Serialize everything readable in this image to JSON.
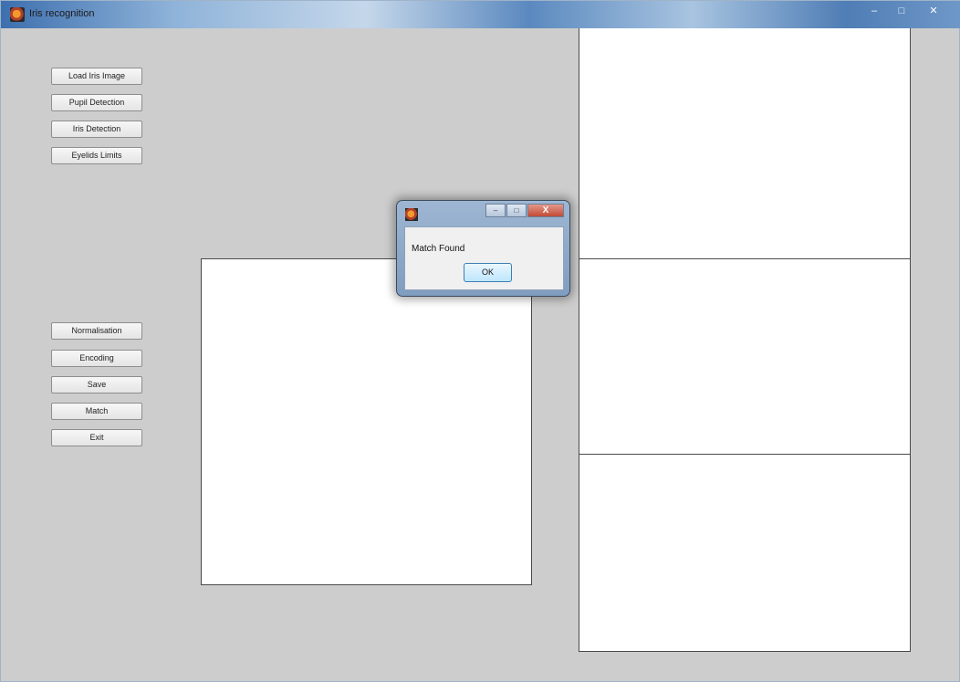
{
  "window": {
    "title": "Iris recognition",
    "controls": [
      "–",
      "□",
      "✕"
    ]
  },
  "buttons_top": [
    {
      "label": "Load Iris Image"
    },
    {
      "label": "Pupil Detection"
    },
    {
      "label": "Iris Detection"
    },
    {
      "label": "Eyelids Limits"
    }
  ],
  "buttons_bottom": [
    {
      "label": "Normalisation"
    },
    {
      "label": "Encoding"
    },
    {
      "label": "Save"
    },
    {
      "label": "Match"
    },
    {
      "label": "Exit"
    }
  ],
  "dialog": {
    "title": "",
    "message": "Match Found",
    "ok_label": "OK",
    "controls": [
      "–",
      "□",
      "X"
    ]
  }
}
